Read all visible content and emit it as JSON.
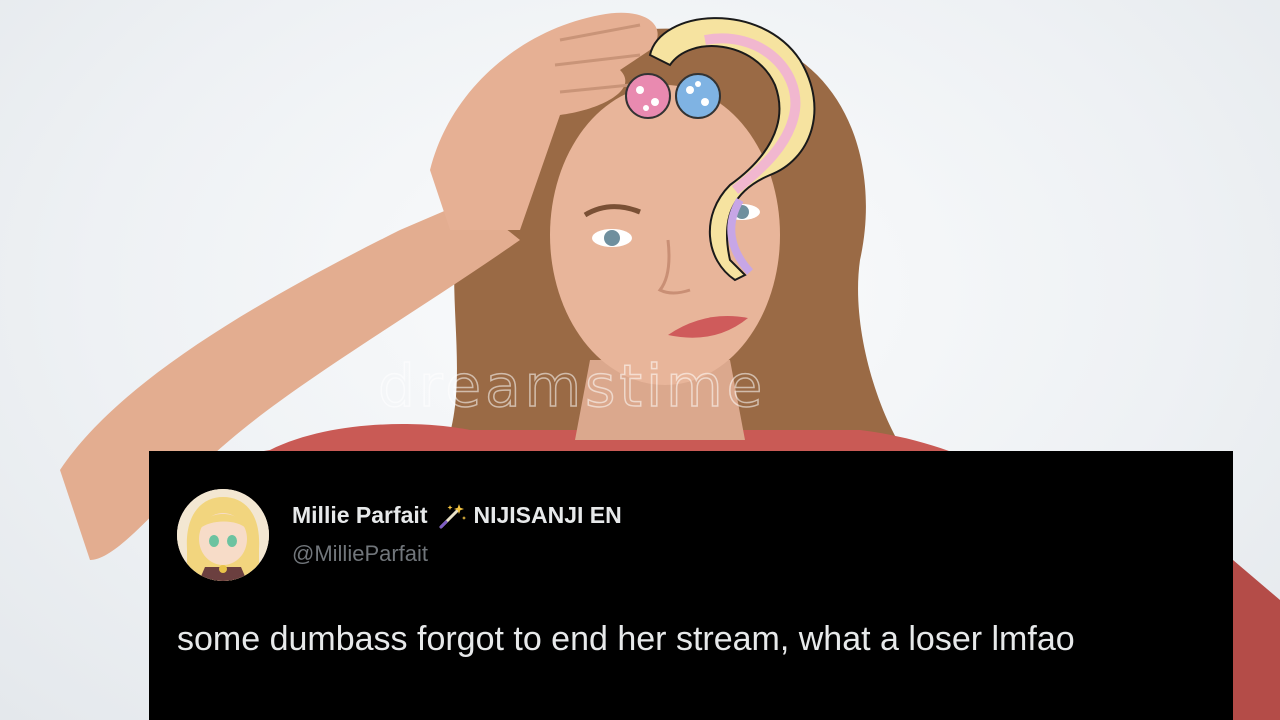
{
  "background": {
    "watermark_text": "dreamstime",
    "sweater_color": "#c95a55",
    "hair_color": "#9a6a45",
    "skin_color": "#e8b59a"
  },
  "overlay_sticker": {
    "icon": "question-mark-hair-sticker-icon",
    "colors": [
      "#f6e3a0",
      "#f1b7cf",
      "#c7a6e6"
    ]
  },
  "tweet": {
    "avatar_icon": "avatar-anime-girl-icon",
    "display_name": "Millie Parfait",
    "badge_icon": "magic-wand-icon",
    "affiliation": "NIJISANJI EN",
    "handle": "@MillieParfait",
    "text": "some dumbass forgot to end her stream, what a loser lmfao",
    "card_color": "#000000",
    "text_color": "#e7e9ea",
    "handle_color": "#71767b"
  }
}
